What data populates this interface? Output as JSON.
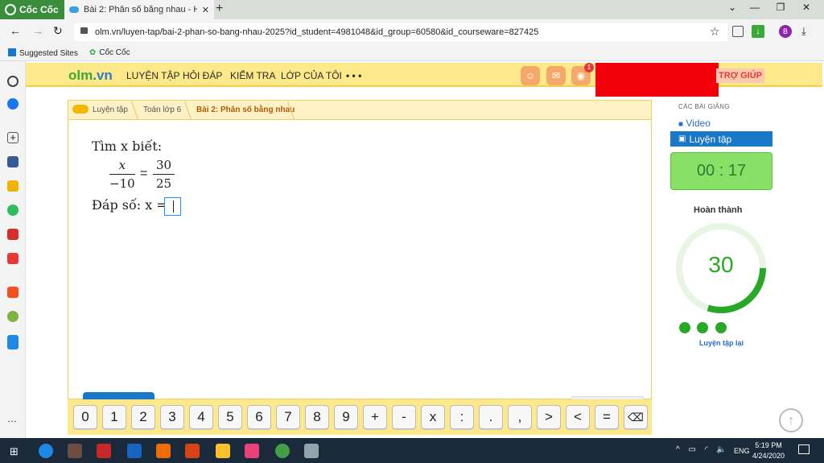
{
  "browser": {
    "brand": "Cốc Cốc",
    "tab_title": "Bài 2: Phân số bằng nhau - H",
    "url": "olm.vn/luyen-tap/bai-2-phan-so-bang-nhau-2025?id_student=4981048&id_group=60580&id_courseware=827425",
    "bookmarks": [
      "Suggested Sites",
      "Cốc Cốc"
    ],
    "profile_initial": "B"
  },
  "site": {
    "logo_a": "olm",
    "logo_b": ".vn",
    "nav": [
      "LUYỆN TẬP",
      "HỎI ĐÁP",
      "KIỂM TRA",
      "LỚP CỦA TÔI",
      "• • •"
    ],
    "notification_count": "1",
    "help": "TRỢ GIÚP"
  },
  "breadcrumb": [
    "Luyện tập",
    "Toán lớp 6",
    "Bài 2: Phân số bằng nhau"
  ],
  "question": {
    "prompt": "Tìm x biết:",
    "left_num": "x",
    "left_den": "−10",
    "equals": "=",
    "right_num": "30",
    "right_den": "25",
    "answer_label": "Đáp số: x ="
  },
  "keypad": [
    "0",
    "1",
    "2",
    "3",
    "4",
    "5",
    "6",
    "7",
    "8",
    "9",
    "+",
    "-",
    "x",
    ":",
    ".",
    ",",
    ">",
    "<",
    "=",
    "⌫"
  ],
  "sidebar": {
    "section_title": "CÁC BÀI GIẢNG",
    "video": "Video",
    "practice": "Luyện tập",
    "timer": "00 : 17",
    "completed_label": "Hoàn thành",
    "score": "30",
    "score_fraction": 0.3,
    "retry": "Luyện tập lại"
  },
  "taskbar": {
    "lang": "ENG",
    "time": "5:19 PM",
    "date": "4/24/2020"
  },
  "colors": {
    "header_yellow": "#fde989",
    "accent_blue": "#1a78c8",
    "green": "#27a827"
  }
}
